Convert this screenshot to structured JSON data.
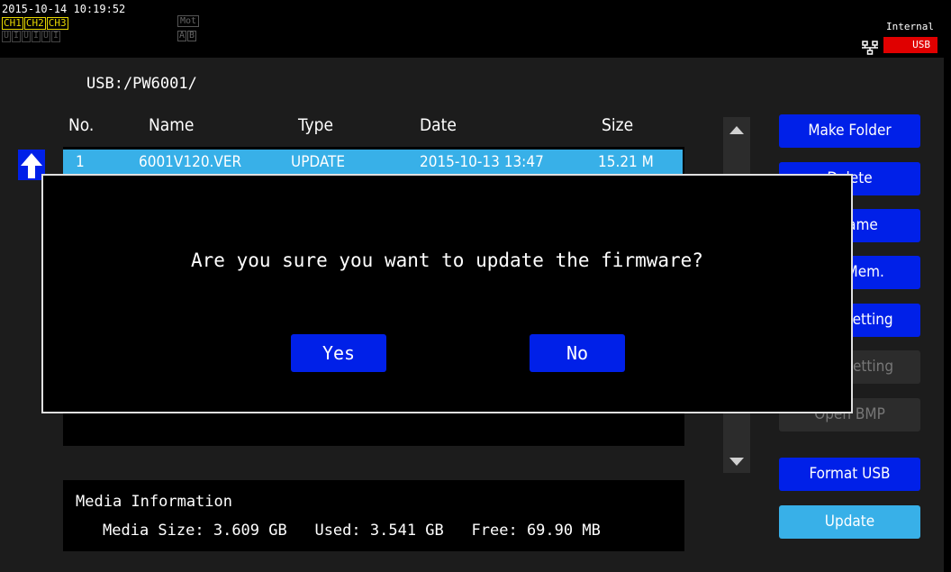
{
  "status": {
    "datetime": "2015-10-14 10:19:52",
    "channels": [
      "CH1",
      "CH2",
      "CH3"
    ],
    "ui_indicators": [
      "U",
      "I",
      "U",
      "I",
      "U",
      "I"
    ],
    "mot": "Mot",
    "ab": [
      "A",
      "B"
    ],
    "storage_internal": "Internal",
    "storage_usb": "USB"
  },
  "path": "USB:/PW6001/",
  "table": {
    "headers": {
      "no": "No.",
      "name": "Name",
      "type": "Type",
      "date": "Date",
      "size": "Size"
    },
    "rows": [
      {
        "no": "1",
        "name": "6001V120.VER",
        "type": "UPDATE",
        "date": "2015-10-13 13:47",
        "size": "15.21 M"
      }
    ]
  },
  "buttons": {
    "make_folder": "Make Folder",
    "delete": "Delete",
    "rename": "Rename",
    "ext_mem": "Ext. Mem.",
    "load_setting": "Load Setting",
    "save_setting": "Save Setting",
    "open_bmp": "Open BMP",
    "format_usb": "Format USB",
    "update": "Update"
  },
  "media": {
    "title": "Media Information",
    "size_label": "Media Size:",
    "size_value": "3.609 GB",
    "used_label": "Used:",
    "used_value": "3.541 GB",
    "free_label": "Free:",
    "free_value": "69.90 MB"
  },
  "dialog": {
    "message": "Are you sure you want to update the firmware?",
    "yes": "Yes",
    "no": "No"
  },
  "colors": {
    "button_blue": "#0020e8",
    "highlight_cyan": "#38b0e8",
    "usb_red": "#e00000",
    "channel_yellow": "#e8d800"
  }
}
